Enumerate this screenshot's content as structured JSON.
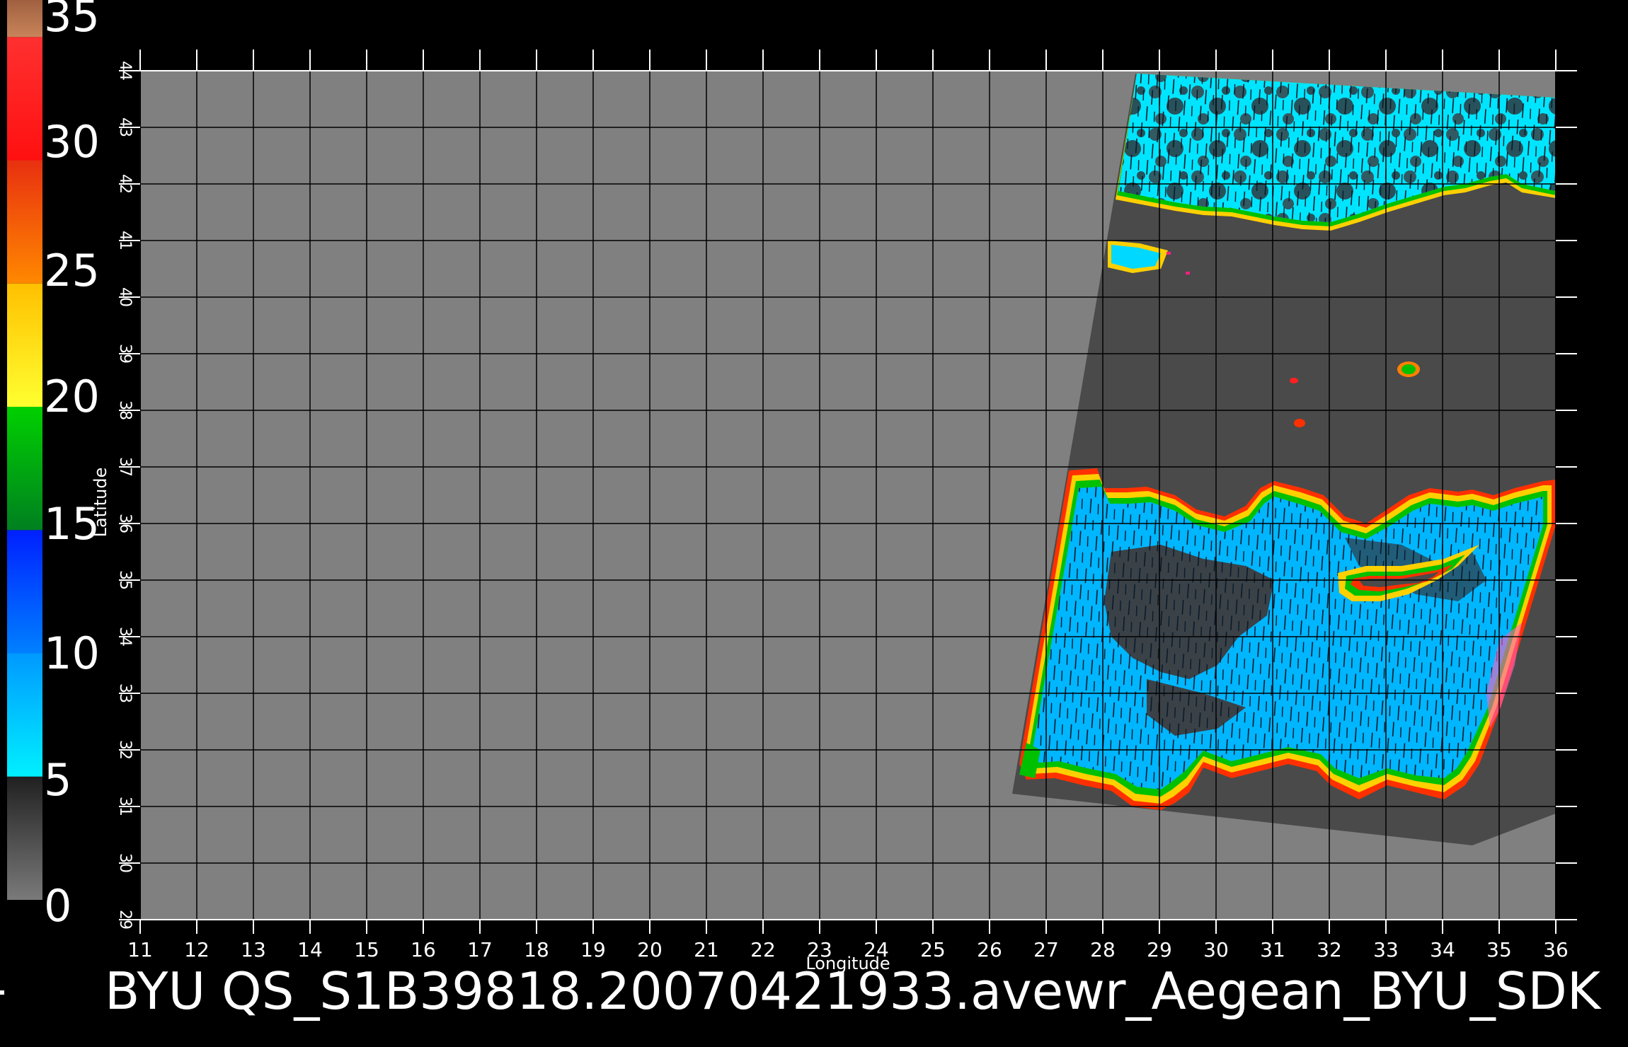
{
  "colorbar": {
    "labels": [
      "35",
      "30",
      "25",
      "20",
      "15",
      "10",
      "5",
      "0"
    ],
    "segments": [
      {
        "from": 0,
        "to": 5,
        "colors": [
          "#7a7a7a",
          "#202020"
        ]
      },
      {
        "from": 5,
        "to": 10,
        "colors": [
          "#00f0ff",
          "#0099ff"
        ]
      },
      {
        "from": 10,
        "to": 15,
        "colors": [
          "#0080ff",
          "#0020ff"
        ]
      },
      {
        "from": 15,
        "to": 20,
        "colors": [
          "#008020",
          "#00d000"
        ]
      },
      {
        "from": 20,
        "to": 25,
        "colors": [
          "#ffff30",
          "#ffc000"
        ]
      },
      {
        "from": 25,
        "to": 30,
        "colors": [
          "#ff8800",
          "#e83010"
        ]
      },
      {
        "from": 30,
        "to": 35,
        "colors": [
          "#ff1010",
          "#ff3030"
        ]
      },
      {
        "from": 35,
        "to": 36.5,
        "colors": [
          "#c8845a",
          "#a06040"
        ]
      }
    ]
  },
  "map": {
    "x_ticks": [
      "11",
      "12",
      "13",
      "14",
      "15",
      "16",
      "17",
      "18",
      "19",
      "20",
      "21",
      "22",
      "23",
      "24",
      "25",
      "26",
      "27",
      "28",
      "29",
      "30",
      "31",
      "32",
      "33",
      "34",
      "35",
      "36"
    ],
    "y_ticks": [
      "29",
      "30",
      "31",
      "32",
      "33",
      "34",
      "35",
      "36",
      "37",
      "38",
      "39",
      "40",
      "41",
      "42",
      "43",
      "44"
    ],
    "x_label": "Longitude",
    "y_label": "Latitude",
    "lon_range": [
      11,
      36
    ],
    "lat_range": [
      29,
      44
    ],
    "land_color": "#808080",
    "swath_color": "#4a4a4a",
    "wind_colors": [
      "#00e5ff",
      "#00c0ff",
      "#0090ff",
      "#0050ff"
    ]
  },
  "title": "BYU  QS_S1B39818.20070421933.avewr_Aegean_BYU_SDK"
}
